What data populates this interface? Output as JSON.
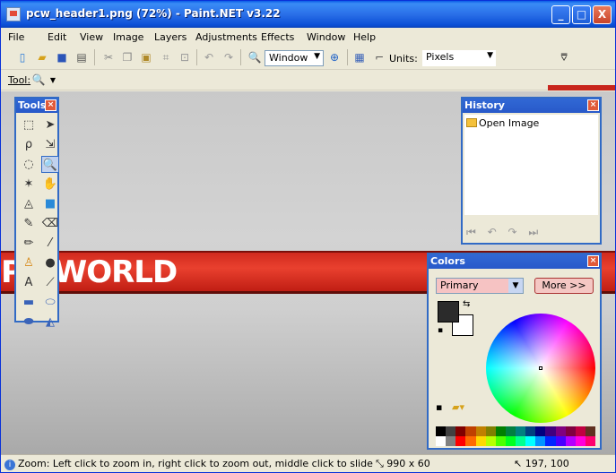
{
  "window": {
    "title": "pcw_header1.png (72%) - Paint.NET v3.22",
    "minimize": "_",
    "maximize": "□",
    "close": "X"
  },
  "menu": [
    "File",
    "Edit",
    "View",
    "Image",
    "Layers",
    "Adjustments",
    "Effects",
    "Window",
    "Help"
  ],
  "toolbar": {
    "zoom_combo": "Window",
    "units_label": "Units:",
    "units_combo": "Pixels"
  },
  "tool_label": "Tool:",
  "tools_panel": {
    "title": "Tools"
  },
  "history_panel": {
    "title": "History",
    "items": [
      "Open Image"
    ]
  },
  "colors_panel": {
    "title": "Colors",
    "combo": "Primary",
    "more_button": "More >>"
  },
  "canvas": {
    "text": "PC WORLD"
  },
  "status": {
    "hint": "Zoom: Left click to zoom in, right click to zoom out, middle click to slide",
    "size": "990 x 60",
    "position": "197, 100"
  },
  "palette_colors": [
    "#000000",
    "#404040",
    "#800000",
    "#c04000",
    "#c08000",
    "#808000",
    "#008000",
    "#008040",
    "#008080",
    "#004080",
    "#000080",
    "#400080",
    "#800080",
    "#800040",
    "#c00040",
    "#603020",
    "#ffffff",
    "#808080",
    "#ff0000",
    "#ff6a00",
    "#ffd800",
    "#b6ff00",
    "#4cff00",
    "#00ff21",
    "#00ff90",
    "#00ffff",
    "#0094ff",
    "#0026ff",
    "#4800ff",
    "#b200ff",
    "#ff00dc",
    "#ff006e"
  ]
}
